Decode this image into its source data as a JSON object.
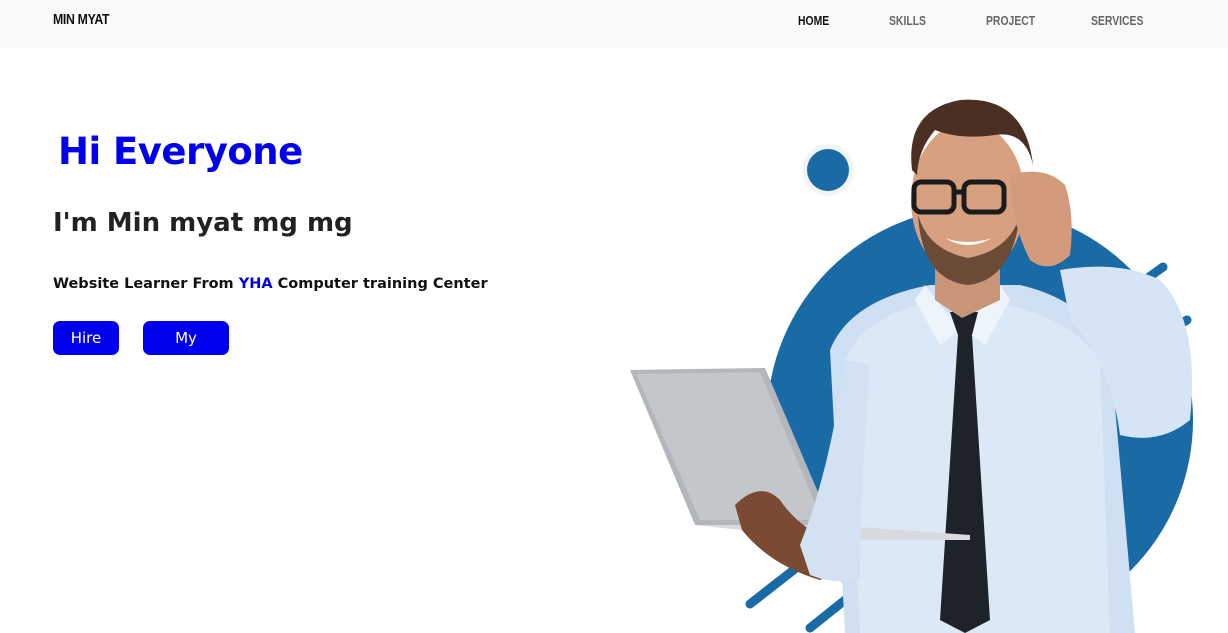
{
  "navbar": {
    "brand": "MIN MYAT",
    "links": [
      {
        "label": "HOME",
        "active": true
      },
      {
        "label": "SKILLS",
        "active": false
      },
      {
        "label": "PROJECT",
        "active": false
      },
      {
        "label": "SERVICES",
        "active": false
      }
    ]
  },
  "hero": {
    "greeting": "Hi Everyone",
    "name_line": "I'm Min myat mg mg",
    "subtitle": {
      "before": "Website Learner From ",
      "highlight": "YHA",
      "after": " Computer training Center"
    },
    "buttons": {
      "hire": "Hire Me",
      "project": "My Project"
    }
  },
  "colors": {
    "accent": "#0000ee",
    "navbar_bg": "#f8f9fa",
    "circle_blue": "#1a6aa5"
  },
  "icons": {
    "hero_image": "man-with-laptop-illustration"
  }
}
